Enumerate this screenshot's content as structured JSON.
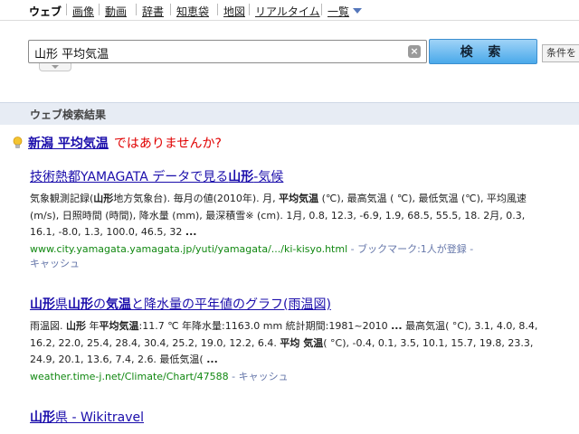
{
  "topnav": {
    "items": [
      {
        "label": "ウェブ",
        "active": true
      },
      {
        "label": "画像"
      },
      {
        "label": "動画"
      },
      {
        "label": "辞書"
      },
      {
        "label": "知恵袋"
      },
      {
        "label": "地図"
      },
      {
        "label": "リアルタイム"
      },
      {
        "label": "一覧"
      }
    ]
  },
  "search": {
    "query": "山形 平均気温",
    "clear_symbol": "×",
    "button_label": "検 索",
    "conditions_label": "条件を"
  },
  "results_heading": "ウェブ検索結果",
  "did_you_mean": {
    "query": "新潟 平均気温",
    "text": "ではありませんか?"
  },
  "results": [
    {
      "title_html": "技術熱都YAMAGATA データで見る<b>山形</b>-気候",
      "snippet_html": "気象観測記録(<b>山形</b>地方気象台). 毎月の値(2010年). 月, <b>平均気温</b> (℃), 最高気温 ( ℃), 最低気温 (℃), 平均風速 (m/s), 日照時間 (時間), 降水量 (mm), 最深積雪※ (cm). 1月, 0.8, 12.3, -6.9, 1.9, 68.5, 55.5, 18. 2月, 0.3, 16.1, -8.0, 1.3, 100.0, 46.5, 32 <b>...</b>",
      "url": "www.city.yamagata.yamagata.jp/yuti/yamagata/.../ki-kisyo.html",
      "extra": " - ブックマーク:1人が登録 -",
      "cache": "キャッシュ"
    },
    {
      "title_html": "<b>山形</b>県<b>山形</b>の<b>気温</b>と降水量の平年値のグラフ(雨温図)",
      "snippet_html": "雨温図. <b>山形</b> 年<b>平均気温</b>:11.7 ℃ 年降水量:1163.0 mm 統計期間:1981~2010 <b>...</b> 最高気温( °C), 3.1, 4.0, 8.4, 16.2, 22.0, 25.4, 28.4, 30.4, 25.2, 19.0, 12.2, 6.4. <b>平均 気温</b>( °C), -0.4, 0.1, 3.5, 10.1, 15.7, 19.8, 23.3, 24.9, 20.1, 13.6, 7.4, 2.6. 最低気温( <b>...</b>",
      "url": "weather.time-j.net/Climate/Chart/47588",
      "extra": " - ",
      "cache": "キャッシュ"
    },
    {
      "title_html": "<b>山形</b>県 - Wikitravel"
    }
  ]
}
